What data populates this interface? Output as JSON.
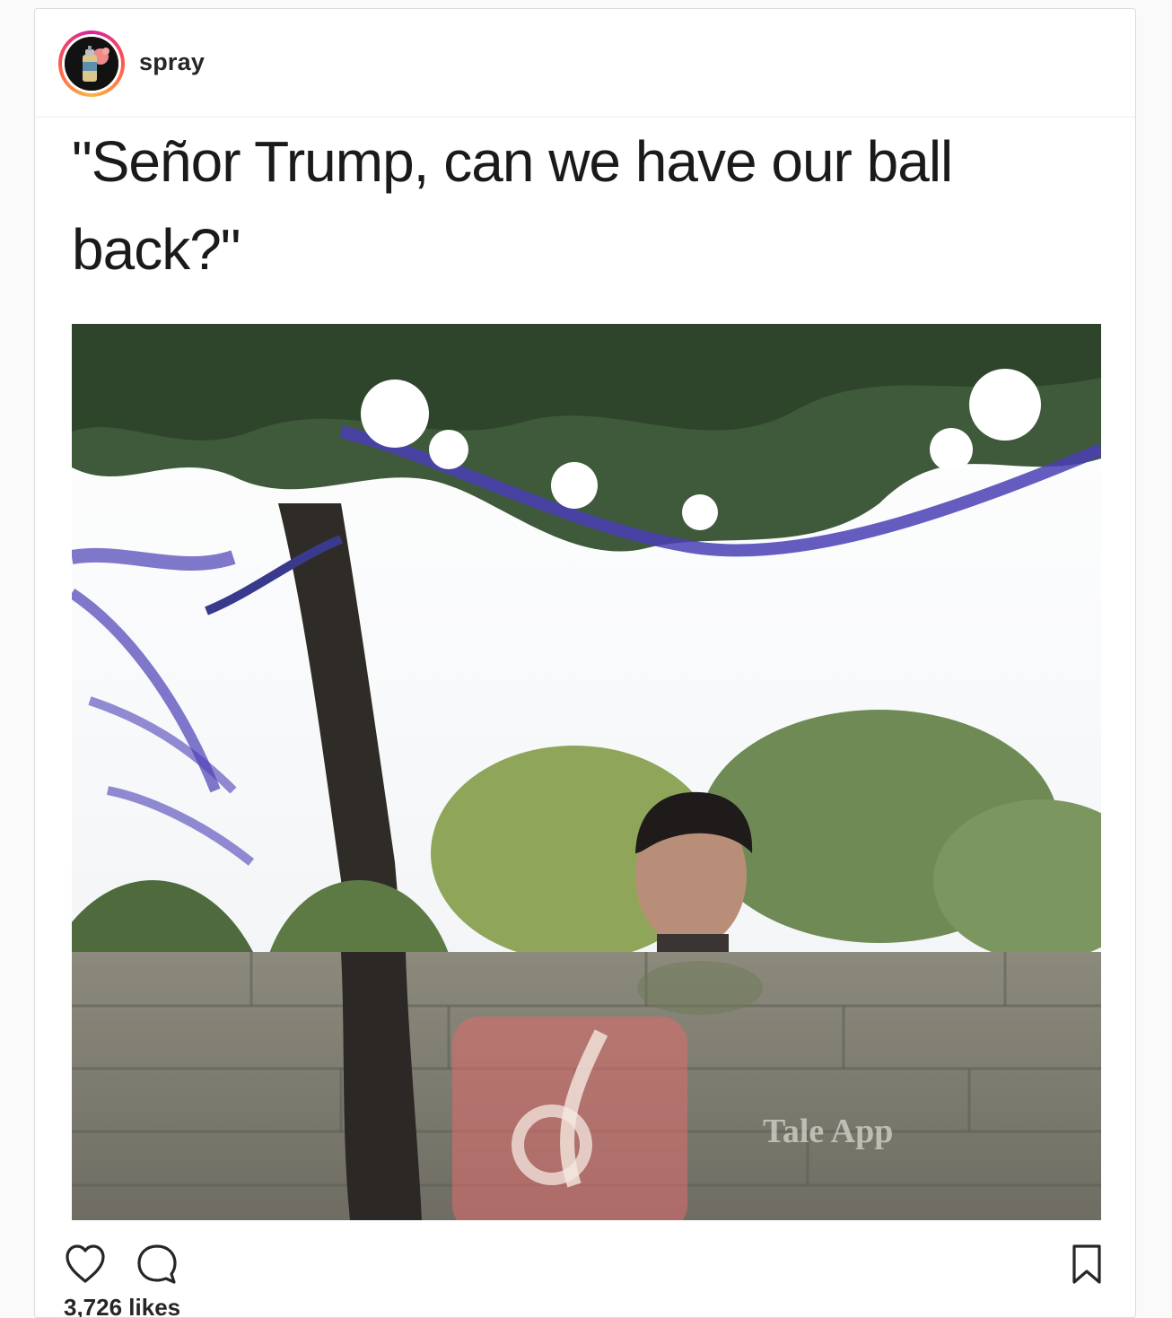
{
  "post": {
    "username": "spray",
    "caption": "\"Señor Trump, can we have our ball back?\"",
    "likes_text": "3,726 likes",
    "watermark": "Tale App"
  },
  "icons": {
    "avatar": "spray-can-avatar",
    "like": "heart-icon",
    "comment": "comment-bubble-icon",
    "save": "bookmark-icon"
  },
  "colors": {
    "border": "#dbdbdb",
    "text": "#262626",
    "story_ring": [
      "#d6249f",
      "#fd5949",
      "#fdb33f"
    ]
  }
}
